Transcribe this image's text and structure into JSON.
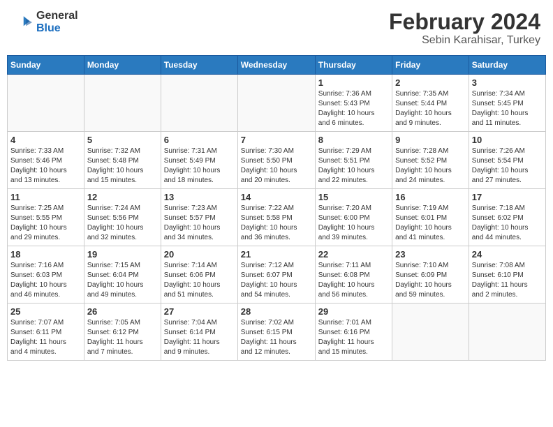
{
  "header": {
    "logo_general": "General",
    "logo_blue": "Blue",
    "month_title": "February 2024",
    "subtitle": "Sebin Karahisar, Turkey"
  },
  "days_of_week": [
    "Sunday",
    "Monday",
    "Tuesday",
    "Wednesday",
    "Thursday",
    "Friday",
    "Saturday"
  ],
  "weeks": [
    [
      {
        "day": "",
        "info": ""
      },
      {
        "day": "",
        "info": ""
      },
      {
        "day": "",
        "info": ""
      },
      {
        "day": "",
        "info": ""
      },
      {
        "day": "1",
        "info": "Sunrise: 7:36 AM\nSunset: 5:43 PM\nDaylight: 10 hours\nand 6 minutes."
      },
      {
        "day": "2",
        "info": "Sunrise: 7:35 AM\nSunset: 5:44 PM\nDaylight: 10 hours\nand 9 minutes."
      },
      {
        "day": "3",
        "info": "Sunrise: 7:34 AM\nSunset: 5:45 PM\nDaylight: 10 hours\nand 11 minutes."
      }
    ],
    [
      {
        "day": "4",
        "info": "Sunrise: 7:33 AM\nSunset: 5:46 PM\nDaylight: 10 hours\nand 13 minutes."
      },
      {
        "day": "5",
        "info": "Sunrise: 7:32 AM\nSunset: 5:48 PM\nDaylight: 10 hours\nand 15 minutes."
      },
      {
        "day": "6",
        "info": "Sunrise: 7:31 AM\nSunset: 5:49 PM\nDaylight: 10 hours\nand 18 minutes."
      },
      {
        "day": "7",
        "info": "Sunrise: 7:30 AM\nSunset: 5:50 PM\nDaylight: 10 hours\nand 20 minutes."
      },
      {
        "day": "8",
        "info": "Sunrise: 7:29 AM\nSunset: 5:51 PM\nDaylight: 10 hours\nand 22 minutes."
      },
      {
        "day": "9",
        "info": "Sunrise: 7:28 AM\nSunset: 5:52 PM\nDaylight: 10 hours\nand 24 minutes."
      },
      {
        "day": "10",
        "info": "Sunrise: 7:26 AM\nSunset: 5:54 PM\nDaylight: 10 hours\nand 27 minutes."
      }
    ],
    [
      {
        "day": "11",
        "info": "Sunrise: 7:25 AM\nSunset: 5:55 PM\nDaylight: 10 hours\nand 29 minutes."
      },
      {
        "day": "12",
        "info": "Sunrise: 7:24 AM\nSunset: 5:56 PM\nDaylight: 10 hours\nand 32 minutes."
      },
      {
        "day": "13",
        "info": "Sunrise: 7:23 AM\nSunset: 5:57 PM\nDaylight: 10 hours\nand 34 minutes."
      },
      {
        "day": "14",
        "info": "Sunrise: 7:22 AM\nSunset: 5:58 PM\nDaylight: 10 hours\nand 36 minutes."
      },
      {
        "day": "15",
        "info": "Sunrise: 7:20 AM\nSunset: 6:00 PM\nDaylight: 10 hours\nand 39 minutes."
      },
      {
        "day": "16",
        "info": "Sunrise: 7:19 AM\nSunset: 6:01 PM\nDaylight: 10 hours\nand 41 minutes."
      },
      {
        "day": "17",
        "info": "Sunrise: 7:18 AM\nSunset: 6:02 PM\nDaylight: 10 hours\nand 44 minutes."
      }
    ],
    [
      {
        "day": "18",
        "info": "Sunrise: 7:16 AM\nSunset: 6:03 PM\nDaylight: 10 hours\nand 46 minutes."
      },
      {
        "day": "19",
        "info": "Sunrise: 7:15 AM\nSunset: 6:04 PM\nDaylight: 10 hours\nand 49 minutes."
      },
      {
        "day": "20",
        "info": "Sunrise: 7:14 AM\nSunset: 6:06 PM\nDaylight: 10 hours\nand 51 minutes."
      },
      {
        "day": "21",
        "info": "Sunrise: 7:12 AM\nSunset: 6:07 PM\nDaylight: 10 hours\nand 54 minutes."
      },
      {
        "day": "22",
        "info": "Sunrise: 7:11 AM\nSunset: 6:08 PM\nDaylight: 10 hours\nand 56 minutes."
      },
      {
        "day": "23",
        "info": "Sunrise: 7:10 AM\nSunset: 6:09 PM\nDaylight: 10 hours\nand 59 minutes."
      },
      {
        "day": "24",
        "info": "Sunrise: 7:08 AM\nSunset: 6:10 PM\nDaylight: 11 hours\nand 2 minutes."
      }
    ],
    [
      {
        "day": "25",
        "info": "Sunrise: 7:07 AM\nSunset: 6:11 PM\nDaylight: 11 hours\nand 4 minutes."
      },
      {
        "day": "26",
        "info": "Sunrise: 7:05 AM\nSunset: 6:12 PM\nDaylight: 11 hours\nand 7 minutes."
      },
      {
        "day": "27",
        "info": "Sunrise: 7:04 AM\nSunset: 6:14 PM\nDaylight: 11 hours\nand 9 minutes."
      },
      {
        "day": "28",
        "info": "Sunrise: 7:02 AM\nSunset: 6:15 PM\nDaylight: 11 hours\nand 12 minutes."
      },
      {
        "day": "29",
        "info": "Sunrise: 7:01 AM\nSunset: 6:16 PM\nDaylight: 11 hours\nand 15 minutes."
      },
      {
        "day": "",
        "info": ""
      },
      {
        "day": "",
        "info": ""
      }
    ]
  ]
}
